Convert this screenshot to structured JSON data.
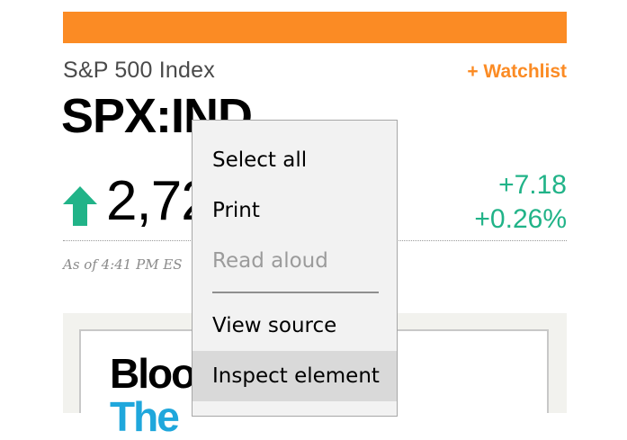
{
  "quote": {
    "index_name": "S&P 500 Index",
    "watchlist_label": "+ Watchlist",
    "ticker": "SPX:IND",
    "price": "2,72",
    "change": "+7.18",
    "change_percent": "+0.26%",
    "timestamp": "As of 4:41 PM ES",
    "up_color": "#21b388",
    "accent_color": "#fb8b24"
  },
  "panel": {
    "logo_line1": "Bloo",
    "logo_line2": "The"
  },
  "context_menu": {
    "items": [
      {
        "label": "Select all",
        "enabled": true
      },
      {
        "label": "Print",
        "enabled": true
      },
      {
        "label": "Read aloud",
        "enabled": false
      },
      {
        "label": "View source",
        "enabled": true
      },
      {
        "label": "Inspect element",
        "enabled": true,
        "highlighted": true
      }
    ]
  }
}
